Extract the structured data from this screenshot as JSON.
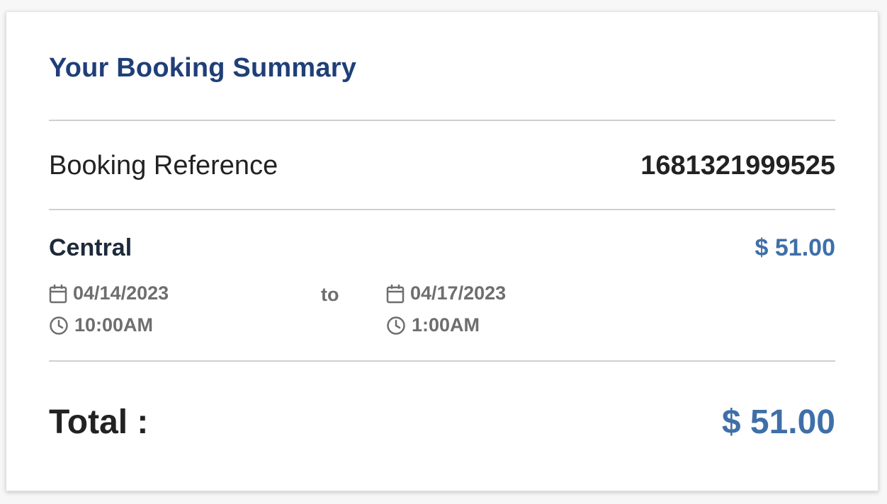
{
  "summary": {
    "title": "Your Booking Summary",
    "reference_label": "Booking Reference",
    "reference_value": "1681321999525",
    "location": {
      "name": "Central",
      "price": "$ 51.00",
      "start_date": "04/14/2023",
      "start_time": "10:00AM",
      "to_label": "to",
      "end_date": "04/17/2023",
      "end_time": "1:00AM"
    },
    "total_label": "Total :",
    "total_value": "$ 51.00"
  },
  "icons": {
    "date": "calendar-icon",
    "time": "clock-icon"
  },
  "colors": {
    "title": "#1f3f78",
    "price": "#3f6fa8",
    "muted": "#6e6e6e"
  }
}
